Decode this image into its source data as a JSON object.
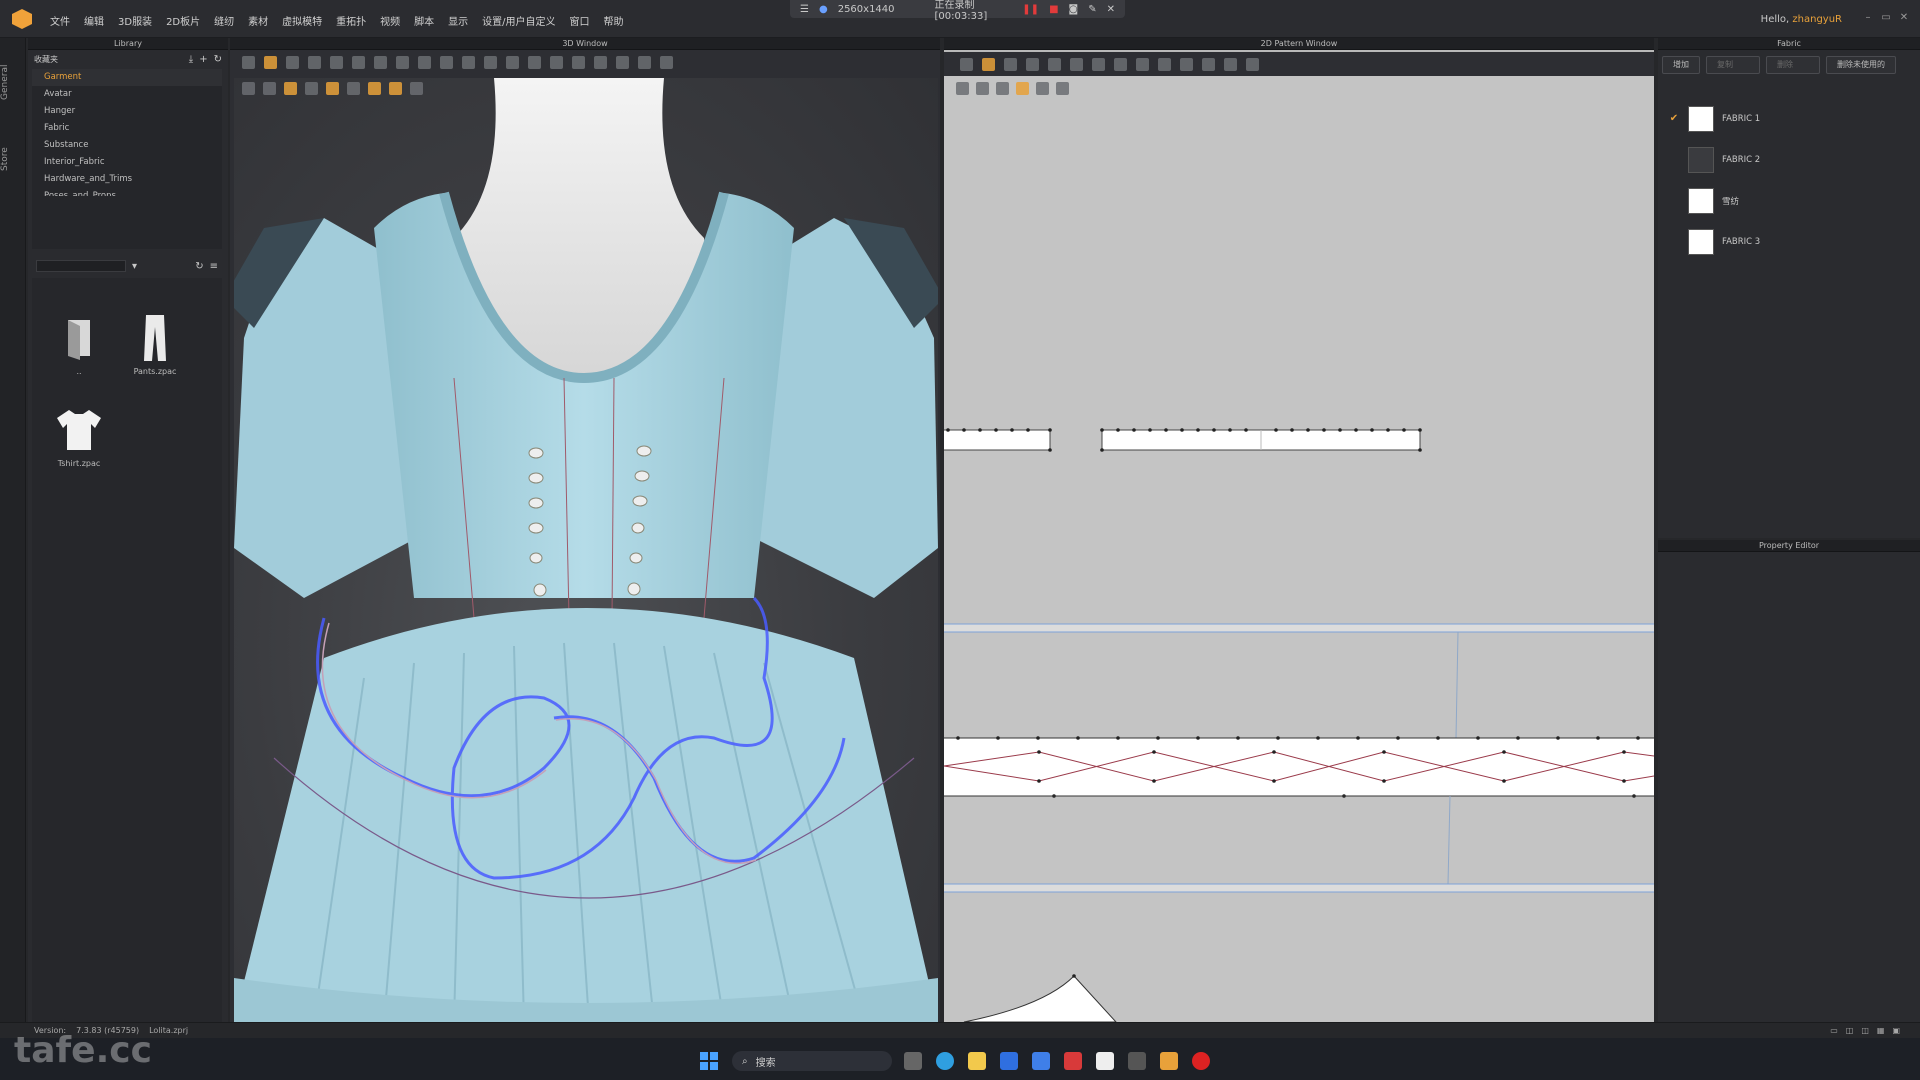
{
  "menu": [
    "文件",
    "编辑",
    "3D服装",
    "2D板片",
    "缝纫",
    "素材",
    "虚拟模特",
    "重拓扑",
    "视频",
    "脚本",
    "显示",
    "设置/用户自定义",
    "窗口",
    "帮助"
  ],
  "recording": {
    "resolution": "2560x1440",
    "status": "正在录制 [00:03:33]"
  },
  "user": {
    "greeting": "Hello,",
    "name": "zhangyuR"
  },
  "vtabs": [
    "General",
    "Store"
  ],
  "library": {
    "title": "Library",
    "favorites_label": "收藏夹",
    "tree": [
      "Garment",
      "Avatar",
      "Hanger",
      "Fabric",
      "Substance",
      "Interior_Fabric",
      "Hardware_and_Trims",
      "Poses_and_Props"
    ],
    "items": [
      {
        "label": "..",
        "icon": "folder-up-icon"
      },
      {
        "label": "Pants.zpac",
        "icon": "pants-icon"
      },
      {
        "label": "Tshirt.zpac",
        "icon": "tshirt-icon"
      }
    ]
  },
  "window3d": {
    "title": "3D Window"
  },
  "window2d": {
    "title": "2D Pattern Window"
  },
  "fabric": {
    "title": "Fabric",
    "buttons": [
      "增加",
      "复制",
      "删除",
      "删除未使用的"
    ],
    "items": [
      {
        "name": "FABRIC 1",
        "checked": true,
        "swatch": "#ffffff"
      },
      {
        "name": "FABRIC 2",
        "checked": false,
        "swatch": "#3a3b3f"
      },
      {
        "name": "雪纺",
        "checked": false,
        "swatch": "#ffffff"
      },
      {
        "name": "FABRIC 3",
        "checked": false,
        "swatch": "#ffffff"
      }
    ]
  },
  "property": {
    "title": "Property Editor"
  },
  "status": {
    "version_label": "Version:",
    "version": "7.3.83 (r45759)",
    "file": "Lolita.zprj"
  },
  "taskbar": {
    "search": "搜索"
  },
  "watermark": "tafe.cc",
  "colors": {
    "accent": "#e8a13a",
    "dress": "#a9d3e0",
    "seam": "#6b4cff",
    "record": "#e23b3b"
  }
}
